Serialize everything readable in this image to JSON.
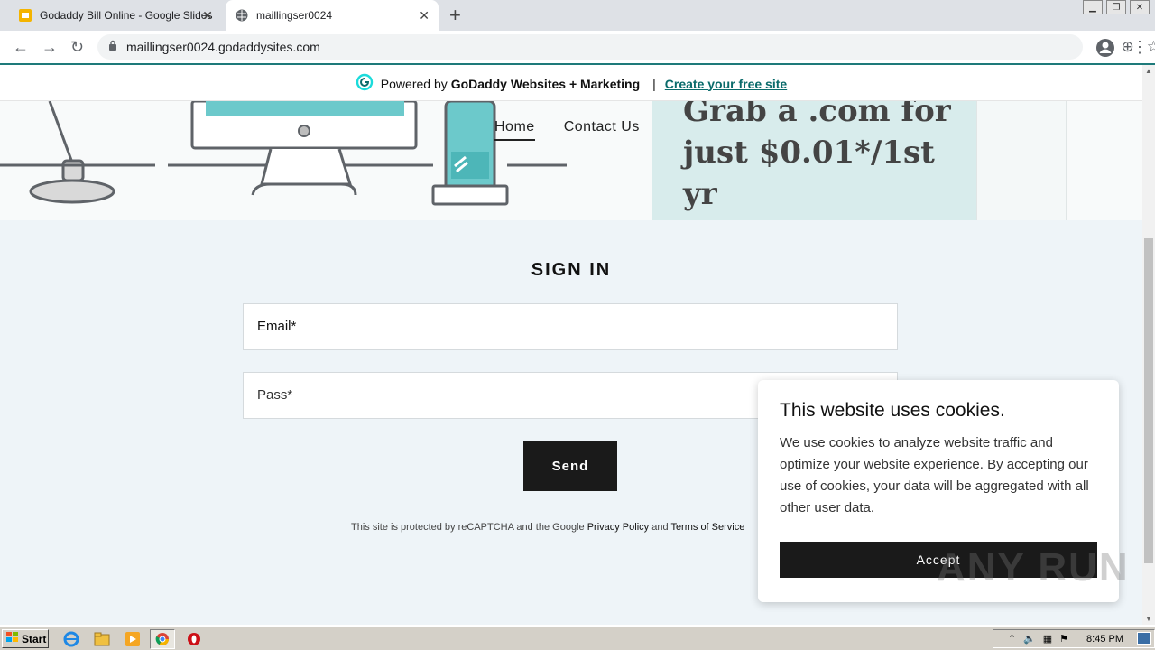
{
  "browser": {
    "tabs": [
      {
        "title": "Godaddy Bill Online - Google Slides",
        "icon": "google-slides-icon"
      },
      {
        "title": "maillingser0024",
        "icon": "globe-icon"
      }
    ],
    "url": "maillingser0024.godaddysites.com"
  },
  "godaddy_bar": {
    "powered_by": "Powered by",
    "brand": "GoDaddy Websites + Marketing",
    "separator": "|",
    "cta": "Create your free site"
  },
  "site": {
    "nav": [
      {
        "label": "Home",
        "active": true
      },
      {
        "label": "Contact Us",
        "active": false
      }
    ],
    "promo_text": "Grab a .com for just $0.01*/1st yr"
  },
  "form": {
    "title": "SIGN IN",
    "email_label": "Email*",
    "pass_label": "Pass*",
    "send_label": "Send",
    "recaptcha_prefix": "This site is protected by reCAPTCHA and the Google",
    "privacy_link": "Privacy Policy",
    "and_text": "and",
    "terms_link": "Terms of Service"
  },
  "cookie": {
    "title": "This website uses cookies.",
    "body": "We use cookies to analyze website traffic and optimize your website experience. By accepting our use of cookies, your data will be aggregated with all other user data.",
    "accept_label": "Accept"
  },
  "taskbar": {
    "start_label": "Start",
    "clock": "8:45 PM"
  },
  "watermark": "ANY RUN"
}
